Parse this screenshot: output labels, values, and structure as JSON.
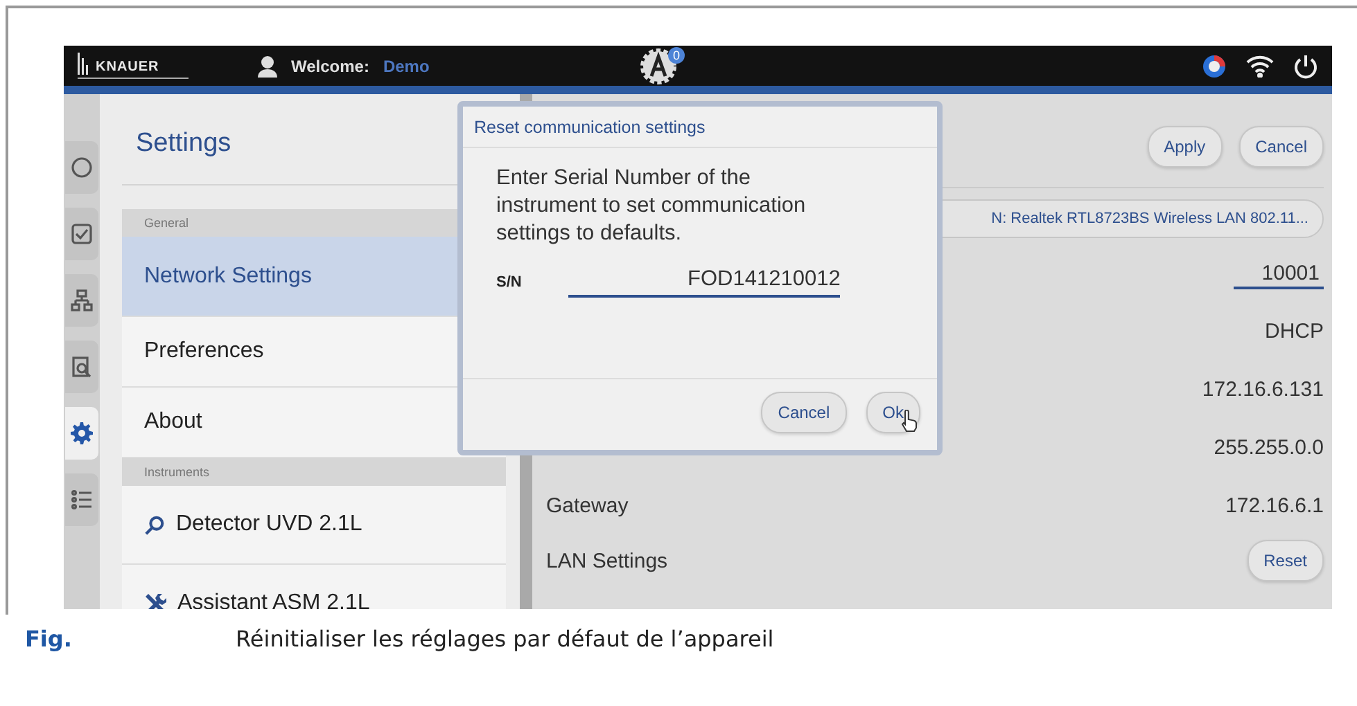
{
  "topbar": {
    "logo": "KNAUER",
    "welcome_label": "Welcome:",
    "user": "Demo",
    "badge": "0"
  },
  "rail": [
    {
      "kind": "circle",
      "selected": false
    },
    {
      "kind": "check",
      "selected": false
    },
    {
      "kind": "tree",
      "selected": false
    },
    {
      "kind": "inspect",
      "selected": false
    },
    {
      "kind": "gear",
      "selected": true
    },
    {
      "kind": "list",
      "selected": false
    }
  ],
  "settings": {
    "title": "Settings",
    "sections": [
      {
        "header": "General",
        "items": [
          {
            "label": "Network Settings",
            "selected": true
          },
          {
            "label": "Preferences",
            "selected": false
          },
          {
            "label": "About",
            "selected": false
          }
        ]
      },
      {
        "header": "Instruments",
        "items": [
          {
            "label": "Detector UVD 2.1L",
            "kind": "search",
            "selected": false
          },
          {
            "label": "Assistant ASM 2.1L",
            "kind": "tools",
            "selected": false
          }
        ]
      }
    ]
  },
  "detail": {
    "buttons": [
      "Apply",
      "Cancel"
    ],
    "rows": [
      {
        "kind": "select",
        "value": "N: Realtek RTL8723BS Wireless LAN 802.11..."
      },
      {
        "kind": "input",
        "value": "10001"
      },
      {
        "kind": "text",
        "value": "DHCP"
      },
      {
        "kind": "text",
        "value": "172.16.6.131"
      },
      {
        "kind": "text",
        "value": "255.255.0.0"
      },
      {
        "kind": "text",
        "label": "Gateway",
        "value": "172.16.6.1"
      },
      {
        "kind": "button",
        "label": "LAN Settings",
        "value": "Reset"
      }
    ]
  },
  "dialog": {
    "title": "Reset communication settings",
    "message": "Enter Serial Number of the instrument to set communication settings to defaults.",
    "field_label": "S/N",
    "field_value": "FOD141210012",
    "buttons": [
      "Cancel",
      "Ok"
    ]
  },
  "caption": {
    "label": "Fig.",
    "text": "Réinitialiser les réglages par défaut de l’appareil"
  }
}
